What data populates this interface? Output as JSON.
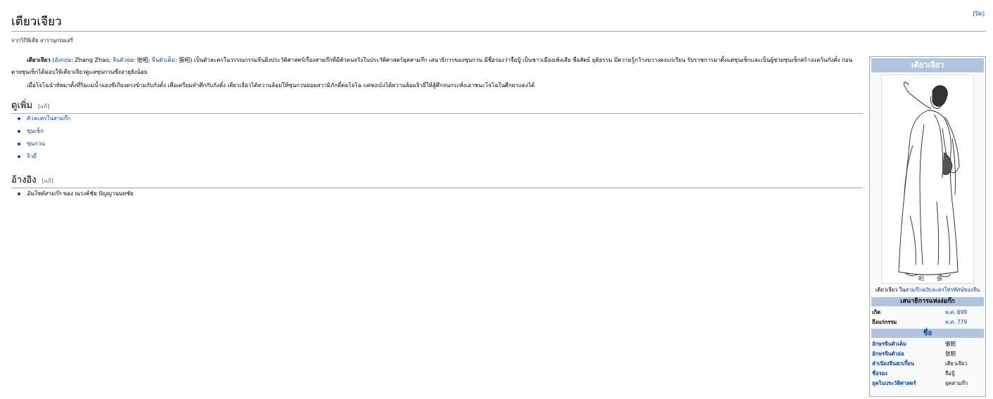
{
  "header": {
    "title": "เตียวเจียว",
    "close_label": "[ปิด]",
    "tagline": "จากวิกิพีเดีย สารานุกรมเสรี"
  },
  "intro": {
    "name_bold": "เตียวเจียว",
    "romanization_label": "อังกฤษ",
    "romanization": "Zhang Zhao",
    "simplified_label": "จีนตัวย่อ",
    "simplified": "张昭",
    "traditional_label": "จีนตัวเต็ม",
    "traditional": "張昭",
    "p1_text_a": "เป็นตัวละครในวรรณกรรมจีนอิงประวัติศาสตร์เรื่องสามก๊กที่มีตัวตนจริงในประวัติศาสตร์ยุคสามก๊ก เสนาธิการของซุนกวน มีชื่อรองว่าจื่อปู้ เป็นชาวเมืองเพ้งเสีย ซื่อสัตย์ ยุติธรรม มีความรู้กว้างขวางคงแก่เรียน รับราชการมาตั้งแต่ซุนเซ็กและเป็นผู้ช่วยซุนเซ็กสร้างแคว้นกังตั๋ง ก่อนตายซุนเซ็กได้มอบให้เตียวเจียวดูแลซุนกวนซึ่งอายุยังน้อย",
    "p2_text": "เมื่อโจโฉนำทัพมาตั้งที่ริมแม่น้ำแยงซีเกียงตรงข้ามกับกังตั๋ง เพื่อเตรียมทำศึกกับกังตั๋ง เตียวเจียวได้ทวานล้อมให้ซุนกวนยอมสวามิภักดิ์ต่อโจโฉ แต่ขงเบ้งได้ทวานล้อมจิวยี่ให้สู้ศึกจนกระทั่งเอาชนะโจโฉในศึกผาแดงได้"
  },
  "see_also": {
    "heading": "ดูเพิ่ม",
    "edit_label": "[แก้]",
    "items": [
      {
        "label": "ตัวละครในสามก๊ก"
      },
      {
        "label": "ซุนเซ็ก"
      },
      {
        "label": "ซุนกวน"
      },
      {
        "label": "จิวยี่"
      }
    ]
  },
  "references": {
    "heading": "อ้างอิง",
    "edit_label": "[แก้]",
    "ref_title": "อินไซด์สามก๊ก",
    "ref_rest": " ของ ณรงค์ชัย ปัญญานนทชัย"
  },
  "infobox": {
    "title": "เตียวเจียว",
    "portrait_icon": "portrait-illustration",
    "caption_plain": "เตียวเจียว ใน",
    "caption_link": "สามก๊กฉบับละครโทรทัศน์ของจีน",
    "section_title": "เสนาธิการแห่งง่อก๊ก",
    "rows_top": [
      {
        "key": "เกิด",
        "value": "พ.ศ. 699"
      },
      {
        "key": "ถึงแก่กรรม",
        "value": "พ.ศ. 779"
      }
    ],
    "names_title": "ชื่อ",
    "rows_names": [
      {
        "key": "อักษรจีนตัวเต็ม",
        "value": "張昭"
      },
      {
        "key": "อักษรจีนตัวย่อ",
        "value": "张昭"
      },
      {
        "key": "สำเนียงจีนฮกเกี้ยน",
        "value": "เตียวเจียว"
      },
      {
        "key": "ชื่อรอง",
        "value": "จื่อปู้"
      },
      {
        "key": "ยุคในประวัติศาสตร์",
        "value": "ยุคสามก๊ก"
      }
    ]
  },
  "colors": {
    "link": "#0645ad",
    "infobox_header": "#b0c4de",
    "rule": "#a2a9b1"
  }
}
